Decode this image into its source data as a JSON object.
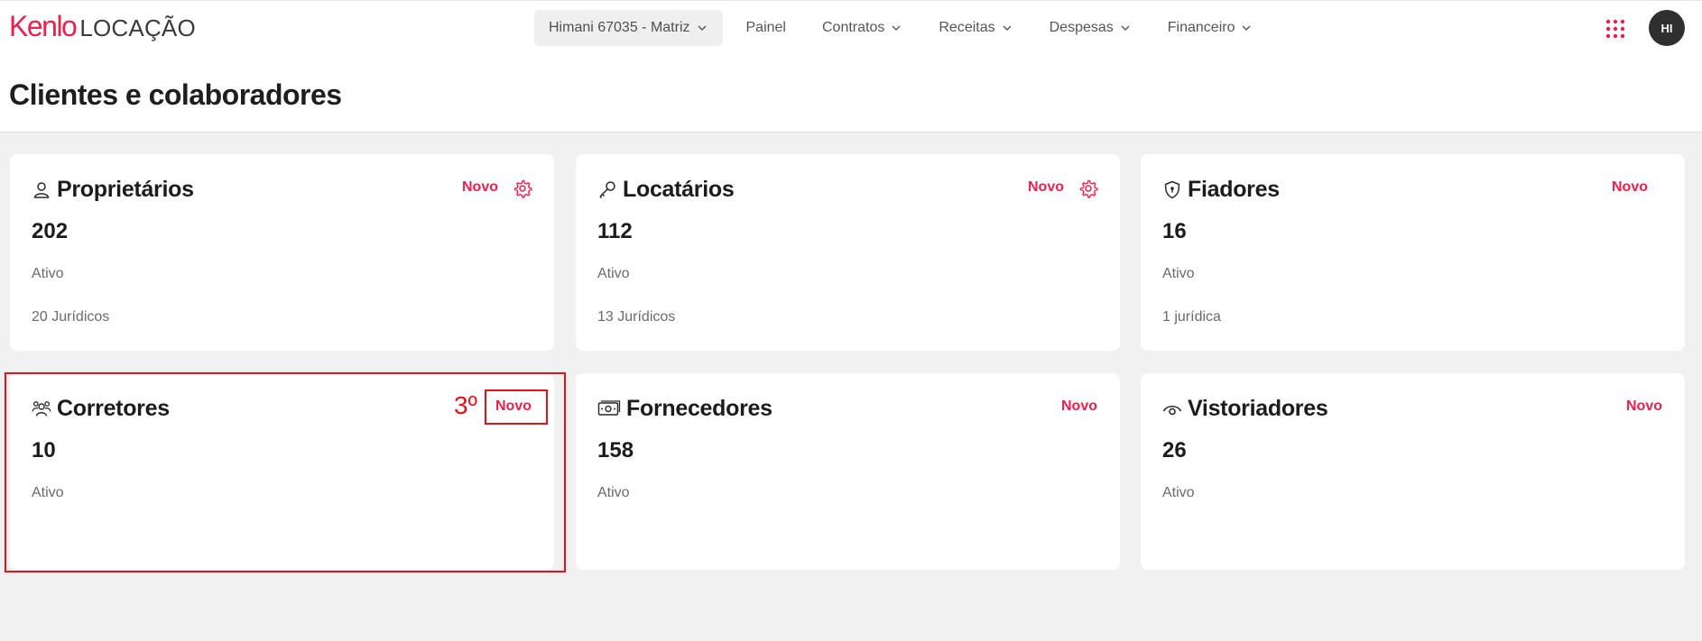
{
  "header": {
    "brand": "Kenlo",
    "product": "LOCAÇÃO",
    "branch": "Himani 67035 - Matriz",
    "nav": [
      "Painel",
      "Contratos",
      "Receitas",
      "Despesas",
      "Financeiro"
    ],
    "avatar": "HI"
  },
  "page": {
    "title": "Clientes e colaboradores"
  },
  "cards": [
    {
      "title": "Proprietários",
      "count": "202",
      "status": "Ativo",
      "sub": "20 Jurídicos",
      "new_label": "Novo",
      "has_settings": true,
      "icon": "person-icon"
    },
    {
      "title": "Locatários",
      "count": "112",
      "status": "Ativo",
      "sub": "13 Jurídicos",
      "new_label": "Novo",
      "has_settings": true,
      "icon": "key-icon"
    },
    {
      "title": "Fiadores",
      "count": "16",
      "status": "Ativo",
      "sub": "1 jurídica",
      "new_label": "Novo",
      "has_settings": false,
      "icon": "shield-icon"
    },
    {
      "title": "Corretores",
      "count": "10",
      "status": "Ativo",
      "sub": "",
      "new_label": "Novo",
      "has_settings": false,
      "icon": "people-icon"
    },
    {
      "title": "Fornecedores",
      "count": "158",
      "status": "Ativo",
      "sub": "",
      "new_label": "Novo",
      "has_settings": false,
      "icon": "money-icon"
    },
    {
      "title": "Vistoriadores",
      "count": "26",
      "status": "Ativo",
      "sub": "",
      "new_label": "Novo",
      "has_settings": false,
      "icon": "eye-icon"
    }
  ],
  "annotation": {
    "step_label": "3º"
  },
  "colors": {
    "accent": "#e8214e",
    "annotation": "#e3111a",
    "background": "#f1f1f1"
  }
}
